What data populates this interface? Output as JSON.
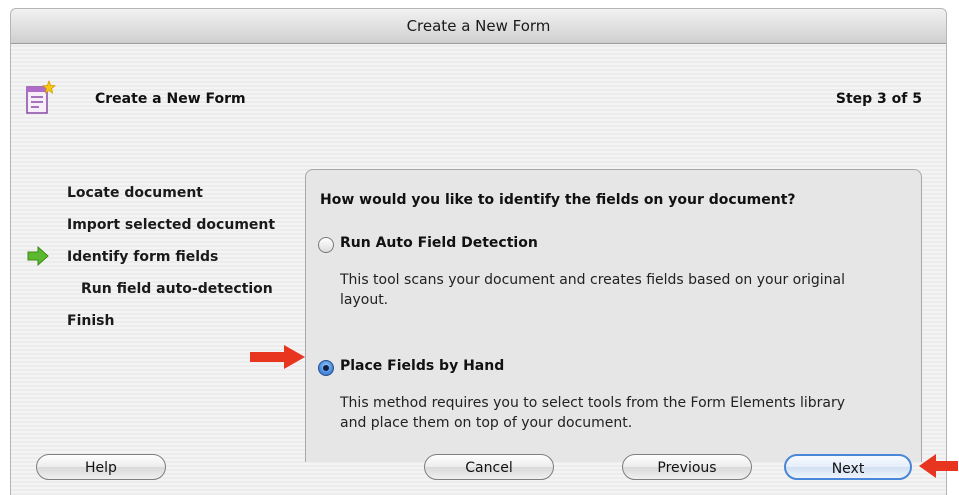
{
  "window": {
    "title": "Create a New Form"
  },
  "header": {
    "title": "Create a New Form",
    "step": "Step 3 of 5",
    "icon": "form-document-icon"
  },
  "steps": [
    {
      "label": "Locate document",
      "sub": false
    },
    {
      "label": "Import selected document",
      "sub": false
    },
    {
      "label": "Identify form fields",
      "sub": false,
      "current": true
    },
    {
      "label": "Run field auto-detection",
      "sub": true
    },
    {
      "label": "Finish",
      "sub": false
    }
  ],
  "panel": {
    "question": "How would you like to identify the fields on your document?",
    "options": [
      {
        "label": "Run Auto Field Detection",
        "selected": false,
        "description": "This tool scans your document and creates fields based on your original layout."
      },
      {
        "label": "Place Fields by Hand",
        "selected": true,
        "description": "This method requires you to select tools from the Form Elements library and place them on top of your document."
      }
    ]
  },
  "buttons": {
    "help": "Help",
    "cancel": "Cancel",
    "previous": "Previous",
    "next": "Next"
  },
  "colors": {
    "annotation_arrow": "#e8351f",
    "step_arrow": "#5cb82e",
    "default_button_border": "#4a86d8"
  }
}
